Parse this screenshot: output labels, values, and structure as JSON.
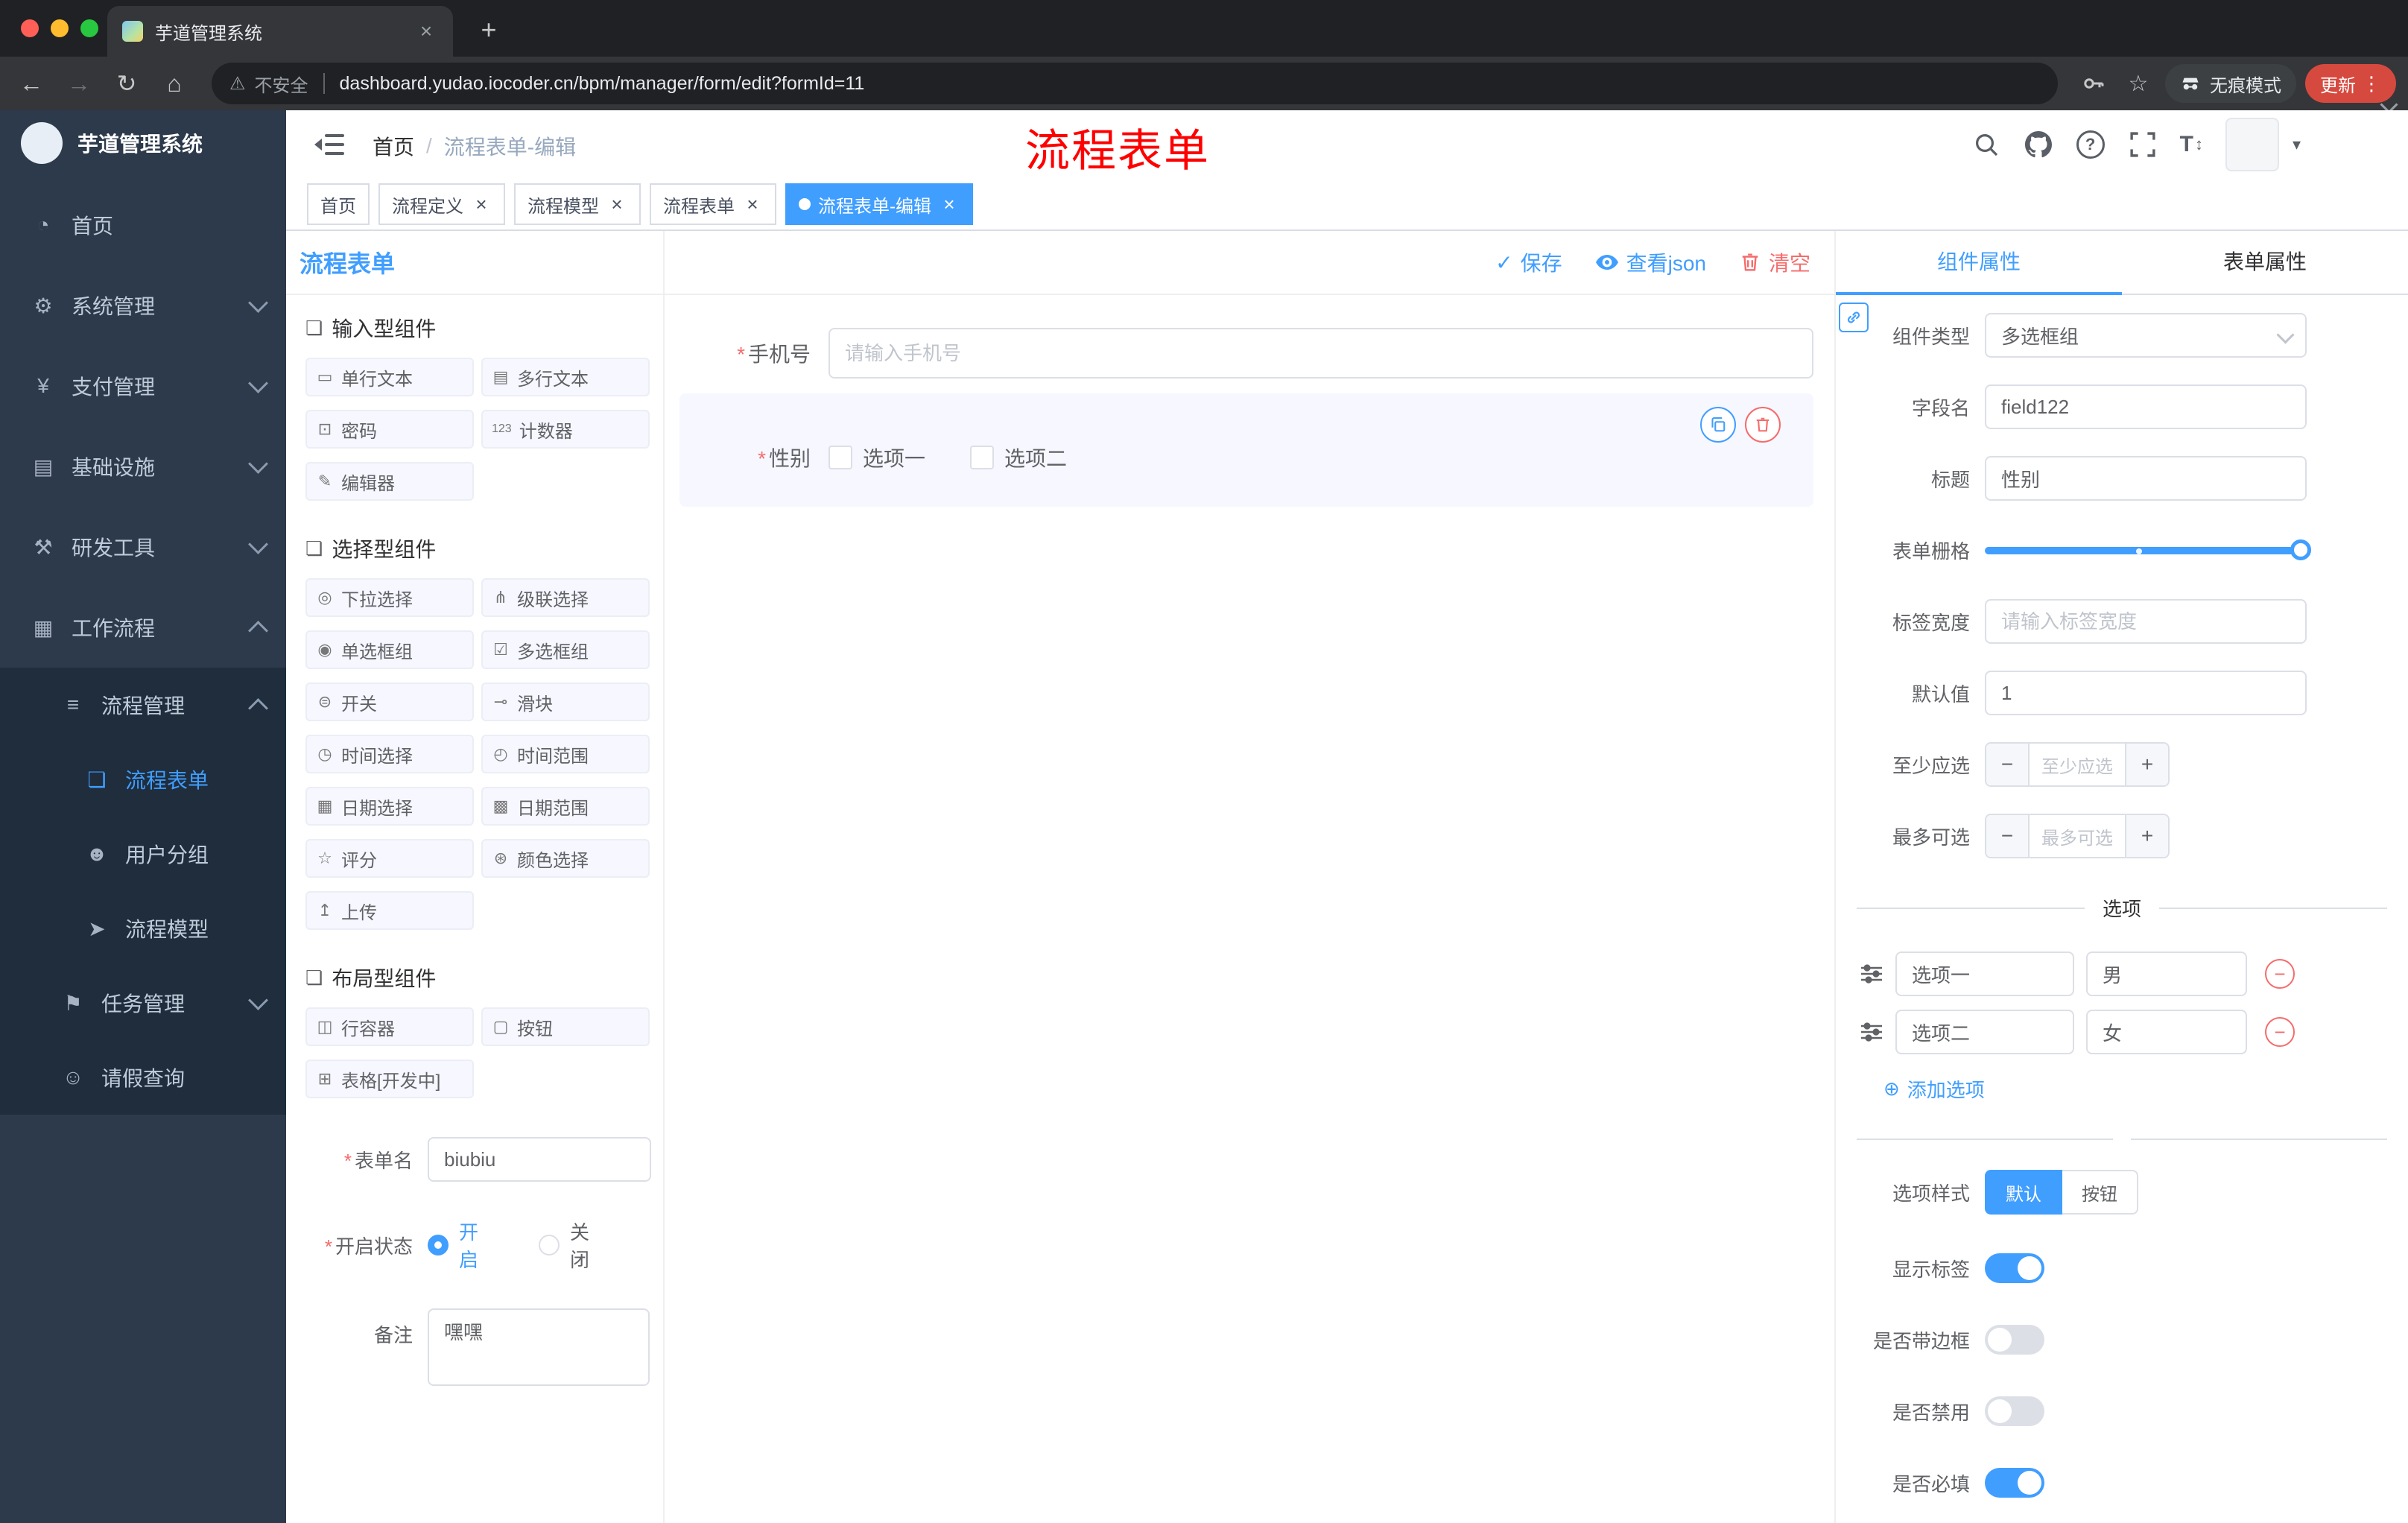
{
  "colors": {
    "accent": "#409eff",
    "danger": "#f56c6c",
    "update_badge": "#d6493f",
    "active_tag": "#409eff"
  },
  "icons": {
    "back": "←",
    "forward": "→",
    "reload": "↻",
    "home": "⌂",
    "warning": "⚠",
    "star": "☆",
    "kebab": "⋮",
    "new_tab": "+",
    "close": "×",
    "check": "✓",
    "question": "?",
    "font_t": "T",
    "font_arrows": "↕",
    "caret": "▾",
    "minus": "−",
    "plus": "+",
    "add_circle": "⊕",
    "remove_circle": "−",
    "section": "❏"
  },
  "browser": {
    "tab_title": "芋道管理系统",
    "security_label": "不安全",
    "url": "dashboard.yudao.iocoder.cn/bpm/manager/form/edit?formId=11",
    "incognito_label": "无痕模式",
    "update_label": "更新"
  },
  "sidebar": {
    "brand": "芋道管理系统",
    "items": [
      {
        "icon": "◔",
        "label": "首页"
      },
      {
        "icon": "⚙",
        "label": "系统管理"
      },
      {
        "icon": "¥",
        "label": "支付管理"
      },
      {
        "icon": "▤",
        "label": "基础设施"
      },
      {
        "icon": "⚒",
        "label": "研发工具"
      },
      {
        "icon": "▦",
        "label": "工作流程"
      },
      {
        "icon": "≡",
        "label": "流程管理"
      },
      {
        "icon": "❏",
        "label": "流程表单"
      },
      {
        "icon": "☻",
        "label": "用户分组"
      },
      {
        "icon": "➤",
        "label": "流程模型"
      },
      {
        "icon": "⚑",
        "label": "任务管理"
      },
      {
        "icon": "☺",
        "label": "请假查询"
      }
    ]
  },
  "header": {
    "breadcrumb_home": "首页",
    "breadcrumb_separator": "/",
    "breadcrumb_current": "流程表单-编辑",
    "annotation": "流程表单"
  },
  "tags": [
    {
      "label": "首页"
    },
    {
      "label": "流程定义"
    },
    {
      "label": "流程模型"
    },
    {
      "label": "流程表单"
    },
    {
      "label": "流程表单-编辑"
    }
  ],
  "designer": {
    "panel_title": "流程表单",
    "required_mark": "*",
    "actions": {
      "save": "保存",
      "view_json": "查看json",
      "clear": "清空"
    },
    "palette_sections": [
      {
        "title": "输入型组件",
        "items": [
          {
            "icon": "▭",
            "label": "单行文本"
          },
          {
            "icon": "▤",
            "label": "多行文本"
          },
          {
            "icon": "⊡",
            "label": "密码"
          },
          {
            "icon": "123",
            "label": "计数器"
          },
          {
            "icon": "✎",
            "label": "编辑器"
          }
        ]
      },
      {
        "title": "选择型组件",
        "items": [
          {
            "icon": "◎",
            "label": "下拉选择"
          },
          {
            "icon": "⋔",
            "label": "级联选择"
          },
          {
            "icon": "◉",
            "label": "单选框组"
          },
          {
            "icon": "☑",
            "label": "多选框组"
          },
          {
            "icon": "⊜",
            "label": "开关"
          },
          {
            "icon": "⊸",
            "label": "滑块"
          },
          {
            "icon": "◷",
            "label": "时间选择"
          },
          {
            "icon": "◴",
            "label": "时间范围"
          },
          {
            "icon": "▦",
            "label": "日期选择"
          },
          {
            "icon": "▩",
            "label": "日期范围"
          },
          {
            "icon": "☆",
            "label": "评分"
          },
          {
            "icon": "⊛",
            "label": "颜色选择"
          },
          {
            "icon": "↥",
            "label": "上传"
          }
        ]
      },
      {
        "title": "布局型组件",
        "items": [
          {
            "icon": "◫",
            "label": "行容器"
          },
          {
            "icon": "▢",
            "label": "按钮"
          },
          {
            "icon": "⊞",
            "label": "表格[开发中]"
          }
        ]
      }
    ],
    "meta": {
      "name_label": "表单名",
      "name_value": "biubiu",
      "status_label": "开启状态",
      "status_on": "开启",
      "status_off": "关闭",
      "remark_label": "备注",
      "remark_value": "嘿嘿"
    },
    "canvas": {
      "phone_label": "手机号",
      "phone_placeholder": "请输入手机号",
      "gender_label": "性别",
      "gender_options": [
        "选项一",
        "选项二"
      ]
    }
  },
  "props": {
    "tabs": [
      "组件属性",
      "表单属性"
    ],
    "component_type_label": "组件类型",
    "component_type_value": "多选框组",
    "field_name_label": "字段名",
    "field_name_value": "field122",
    "title_label": "标题",
    "title_value": "性别",
    "grid_label": "表单栅格",
    "label_width_label": "标签宽度",
    "label_width_placeholder": "请输入标签宽度",
    "default_label": "默认值",
    "default_value": "1",
    "min_label": "至少应选",
    "min_placeholder": "至少应选",
    "max_label": "最多可选",
    "max_placeholder": "最多可选",
    "options_divider": "选项",
    "options": [
      {
        "label": "选项一",
        "value": "男"
      },
      {
        "label": "选项二",
        "value": "女"
      }
    ],
    "add_option": "添加选项",
    "option_style_label": "选项样式",
    "option_style_default": "默认",
    "option_style_button": "按钮",
    "switches": [
      {
        "label": "显示标签",
        "on": true
      },
      {
        "label": "是否带边框",
        "on": false
      },
      {
        "label": "是否禁用",
        "on": false
      },
      {
        "label": "是否必填",
        "on": true
      }
    ]
  }
}
